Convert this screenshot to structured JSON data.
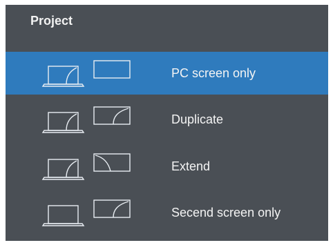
{
  "title": "Project",
  "options": [
    {
      "label": "PC screen only",
      "icon": "pc-screen-only-icon",
      "selected": true
    },
    {
      "label": "Duplicate",
      "icon": "duplicate-icon",
      "selected": false
    },
    {
      "label": "Extend",
      "icon": "extend-icon",
      "selected": false
    },
    {
      "label": "Secend screen only",
      "icon": "second-screen-only-icon",
      "selected": false
    }
  ],
  "colors": {
    "panel": "#4a4f55",
    "selected": "#2f7bbd",
    "text": "#f4f4f4"
  }
}
